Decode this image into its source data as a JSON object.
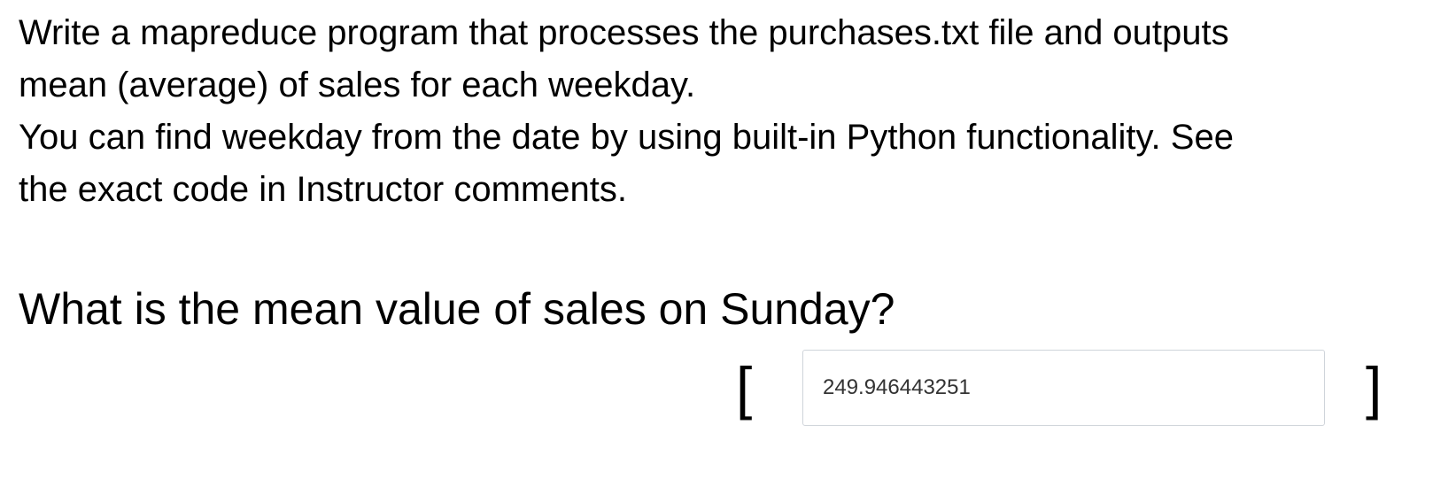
{
  "instructions": {
    "line1": "Write a mapreduce program that processes the purchases.txt file and outputs",
    "line2": "mean (average) of sales for each weekday.",
    "line3": "You can find weekday from the date by using built-in Python functionality. See",
    "line4": "the exact code in Instructor comments."
  },
  "question": {
    "text": "What is the mean value of sales on Sunday?",
    "bracket_open": "[",
    "bracket_close": "]"
  },
  "answer": {
    "value": "249.946443251"
  }
}
